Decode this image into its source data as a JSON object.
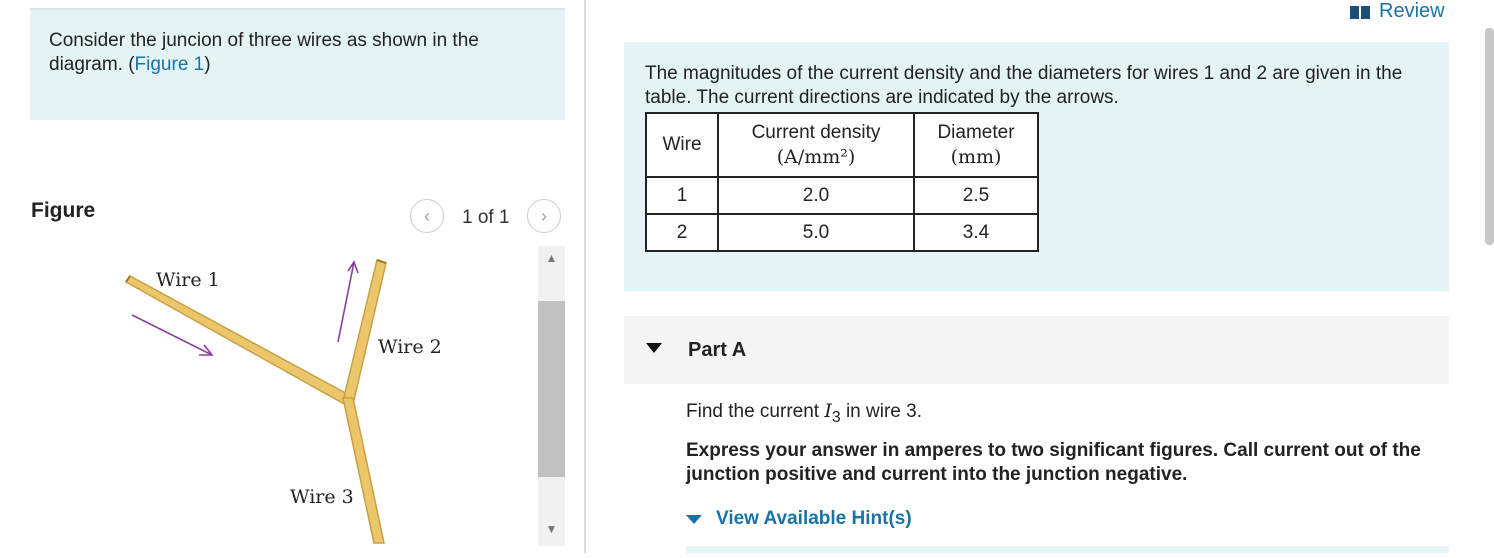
{
  "left": {
    "intro_prefix": "Consider the juncion of three wires as shown in the diagram. (",
    "intro_link": "Figure 1",
    "intro_suffix": ")",
    "figure_label": "Figure",
    "pager": "1 of 1",
    "figure": {
      "wire1": "Wire 1",
      "wire2": "Wire 2",
      "wire3": "Wire 3",
      "wire_color": "#ecc66a",
      "wire_edge": "#c9a043",
      "arrow_color": "#8a3fa0"
    }
  },
  "right": {
    "review": "Review",
    "context": "The magnitudes of the current density and the diameters for wires 1 and 2 are given in the table. The current directions are indicated by the arrows.",
    "table": {
      "headers": {
        "wire": "Wire",
        "cd_line1": "Current density",
        "cd_line2": "(A/mm²)",
        "dia_line1": "Diameter",
        "dia_line2": "(mm)"
      },
      "rows": [
        {
          "wire": "1",
          "cd": "2.0",
          "dia": "2.5"
        },
        {
          "wire": "2",
          "cd": "5.0",
          "dia": "3.4"
        }
      ]
    },
    "part_title": "Part A",
    "question_prefix": "Find the current ",
    "question_var": "I",
    "question_sub": "3",
    "question_suffix": " in wire 3.",
    "instructions": "Express your answer in amperes to two significant figures. Call current out of the junction positive and current into the junction negative.",
    "hint_label": "View Available Hint(s)"
  },
  "colors": {
    "accent": "#1a73a8",
    "panel_bg": "#e4f4f4",
    "part_bg": "#f5f5f5"
  }
}
